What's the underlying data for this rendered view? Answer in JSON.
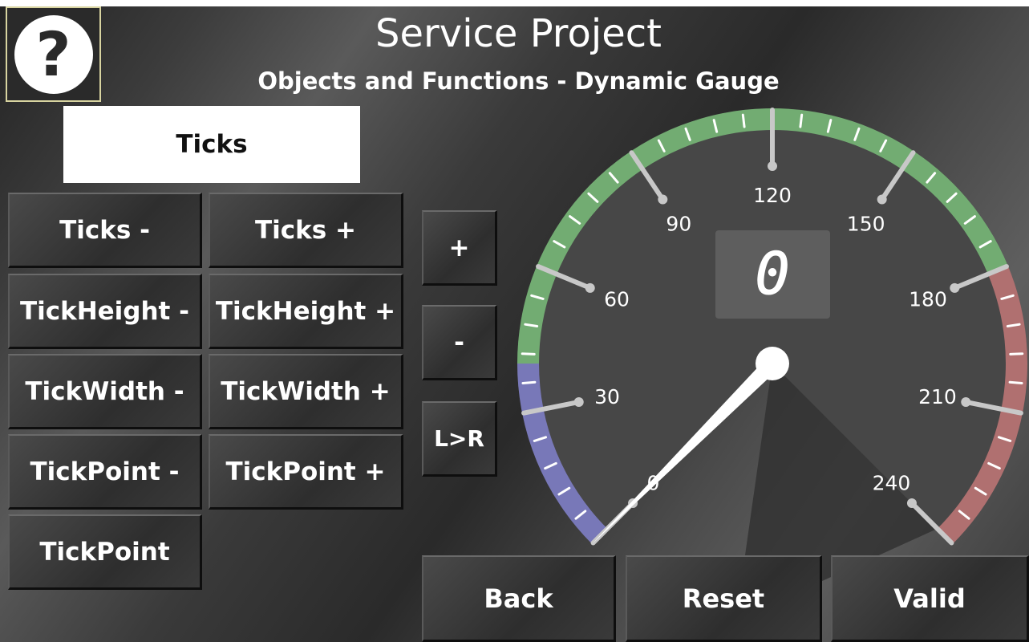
{
  "header": {
    "title": "Service Project",
    "subtitle": "Objects and Functions - Dynamic Gauge",
    "help_symbol": "?"
  },
  "panel": {
    "label": "Ticks"
  },
  "left_buttons": [
    {
      "label": "Ticks -"
    },
    {
      "label": "Ticks +"
    },
    {
      "label": "TickHeight -"
    },
    {
      "label": "TickHeight +"
    },
    {
      "label": "TickWidth -"
    },
    {
      "label": "TickWidth +"
    },
    {
      "label": "TickPoint -"
    },
    {
      "label": "TickPoint +"
    },
    {
      "label": "TickPoint"
    }
  ],
  "mid_buttons": {
    "plus": "+",
    "minus": "-",
    "direction": "L>R"
  },
  "footer": {
    "back": "Back",
    "reset": "Reset",
    "valid": "Valid"
  },
  "gauge": {
    "readout": "0",
    "value": 0,
    "min": 0,
    "max": 240,
    "major_labels": [
      "0",
      "30",
      "60",
      "90",
      "120",
      "150",
      "180",
      "210",
      "240"
    ],
    "minor_ticks_per_major": 4,
    "zones": [
      {
        "from": 0,
        "to": 40,
        "color": "#7878b8"
      },
      {
        "from": 40,
        "to": 180,
        "color": "#72ac72"
      },
      {
        "from": 180,
        "to": 240,
        "color": "#b07070"
      }
    ],
    "colors": {
      "face": "#474747",
      "needle": "#ffffff",
      "tick": "#ffffff",
      "major_tick": "#c8c8c8",
      "readout_bg": "#5e5e5e"
    }
  }
}
